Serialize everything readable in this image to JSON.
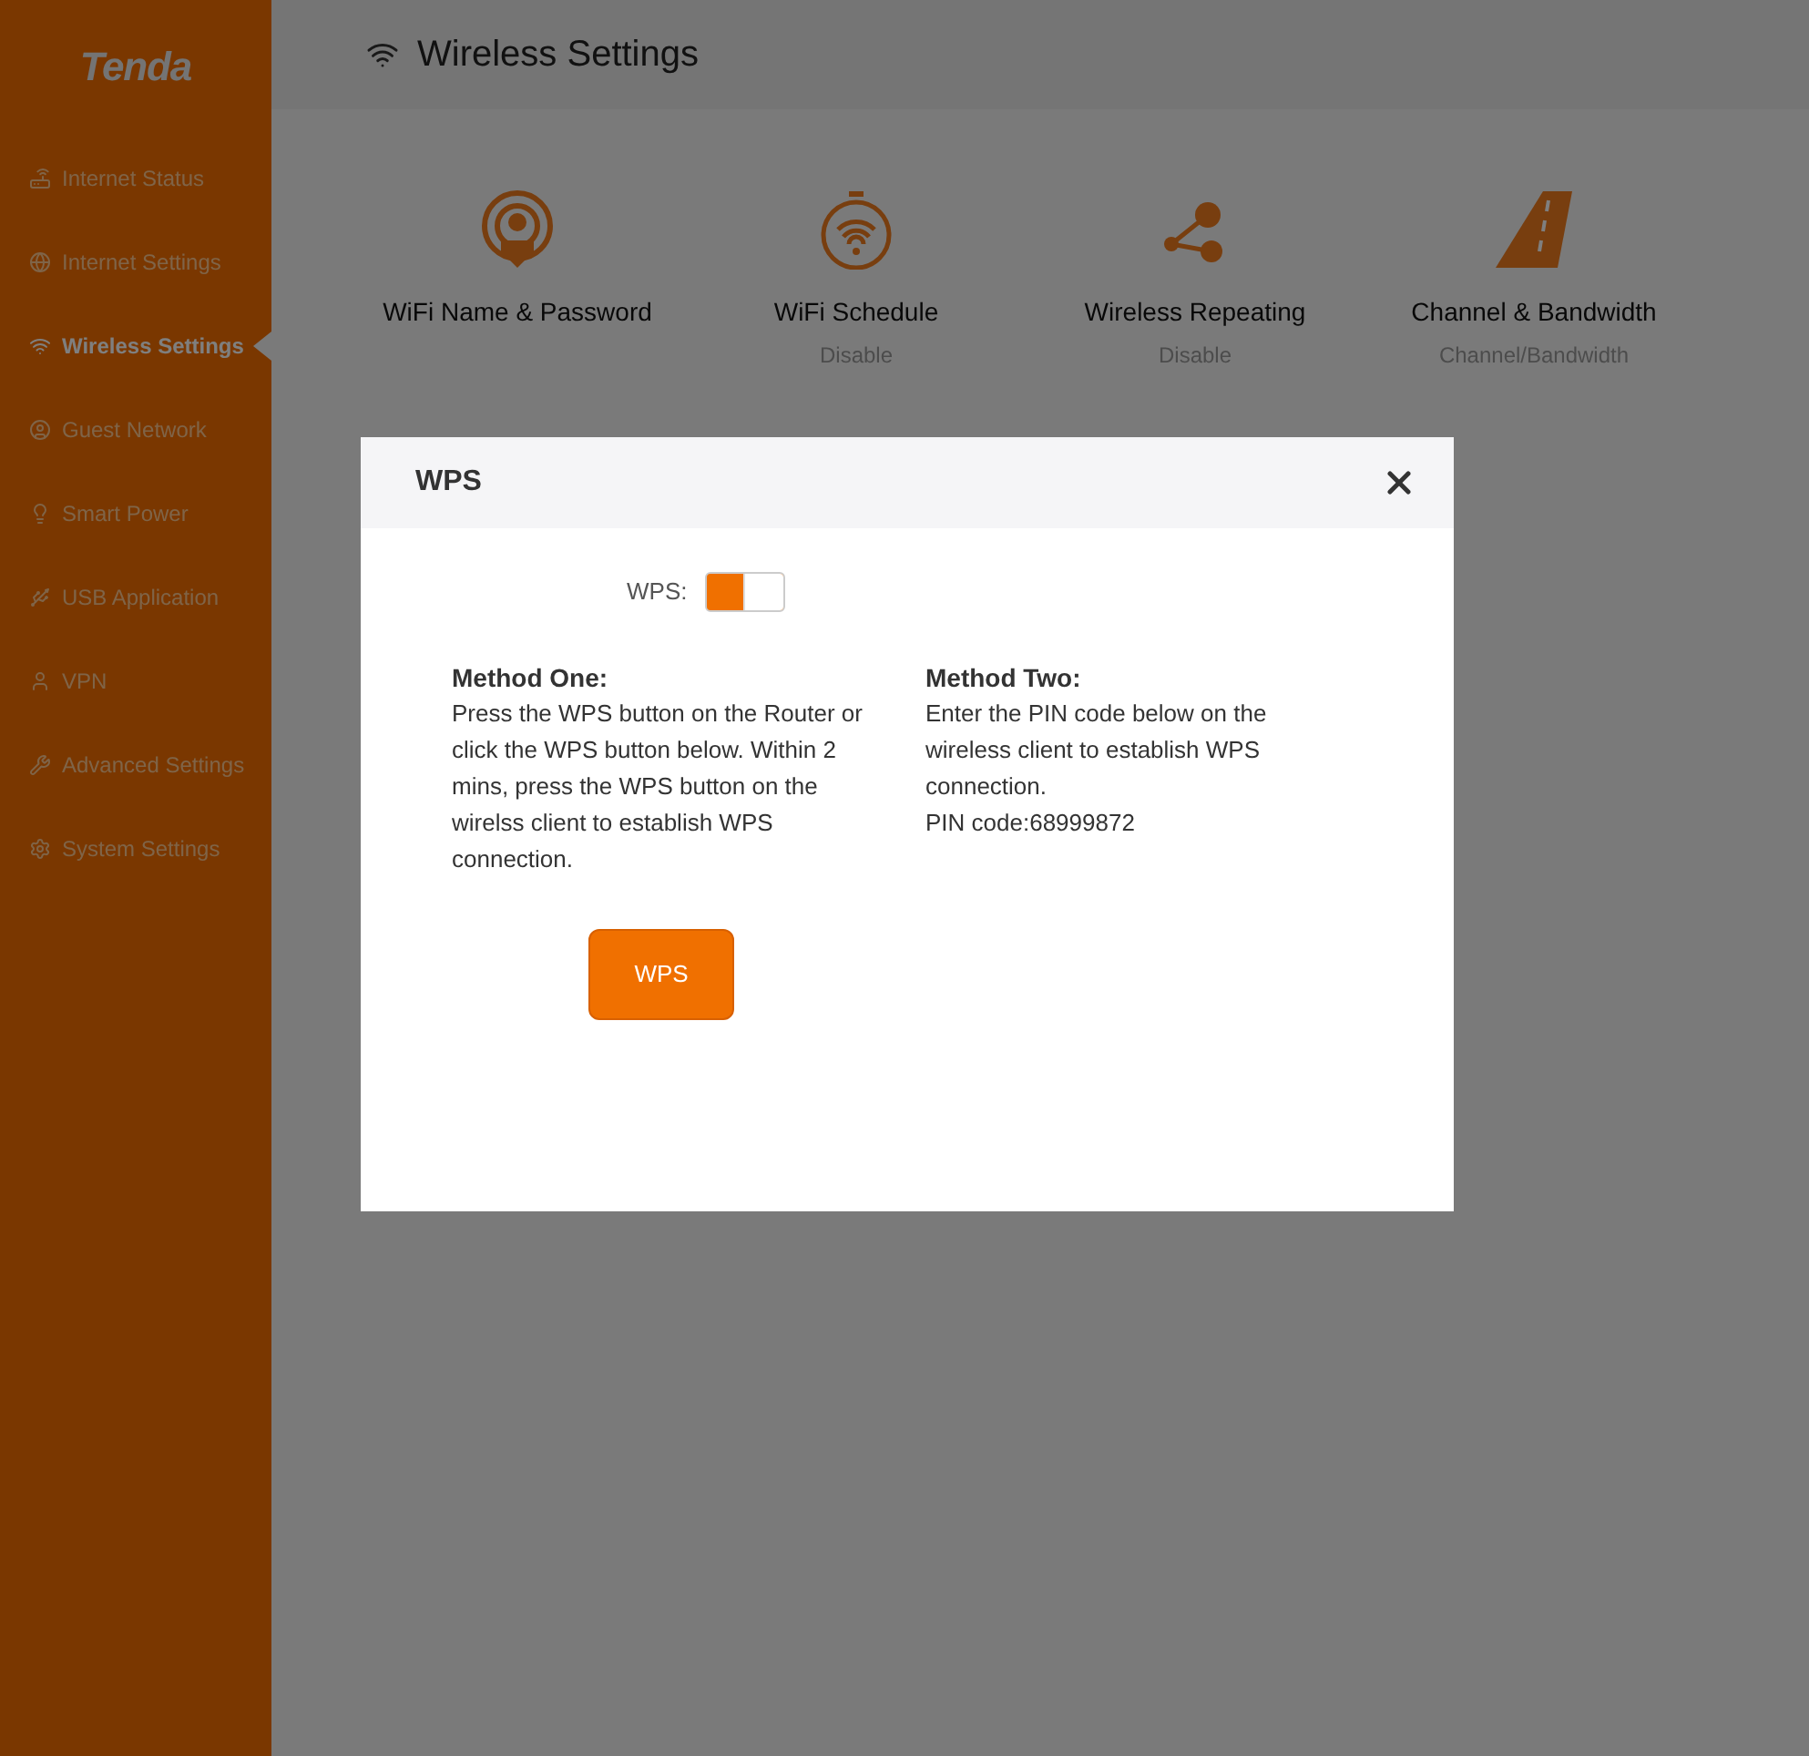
{
  "logo": "Tenda",
  "sidebar": {
    "items": [
      {
        "label": "Internet Status",
        "selected": false
      },
      {
        "label": "Internet Settings",
        "selected": false
      },
      {
        "label": "Wireless Settings",
        "selected": true
      },
      {
        "label": "Guest Network",
        "selected": false
      },
      {
        "label": "Smart Power",
        "selected": false
      },
      {
        "label": "USB Application",
        "selected": false
      },
      {
        "label": "VPN",
        "selected": false
      },
      {
        "label": "Advanced Settings",
        "selected": false
      },
      {
        "label": "System Settings",
        "selected": false
      }
    ]
  },
  "header": {
    "title": "Wireless Settings"
  },
  "tiles": [
    {
      "kind": "wifi-name",
      "label": "WiFi Name & Password"
    },
    {
      "kind": "schedule",
      "label": "WiFi Schedule",
      "status": "Disable"
    },
    {
      "kind": "repeating",
      "label": "Wireless Repeating",
      "status": "Disable"
    },
    {
      "kind": "channel",
      "label": "Channel & Bandwidth",
      "status": "Channel/Bandwidth"
    }
  ],
  "dialog": {
    "title": "WPS",
    "toggle_label": "WPS:",
    "on": true,
    "methods": [
      {
        "title": "Method One:",
        "lines": [
          "Press the WPS button on the Router or click the WPS button below. Within 2 mins, press the WPS button on the wirelss client to establish WPS connection."
        ]
      },
      {
        "title": "Method Two:",
        "lines": [
          "Enter the PIN code below on the wireless client to establish WPS connection.",
          "PIN code:68999872"
        ]
      }
    ],
    "button": "WPS"
  }
}
